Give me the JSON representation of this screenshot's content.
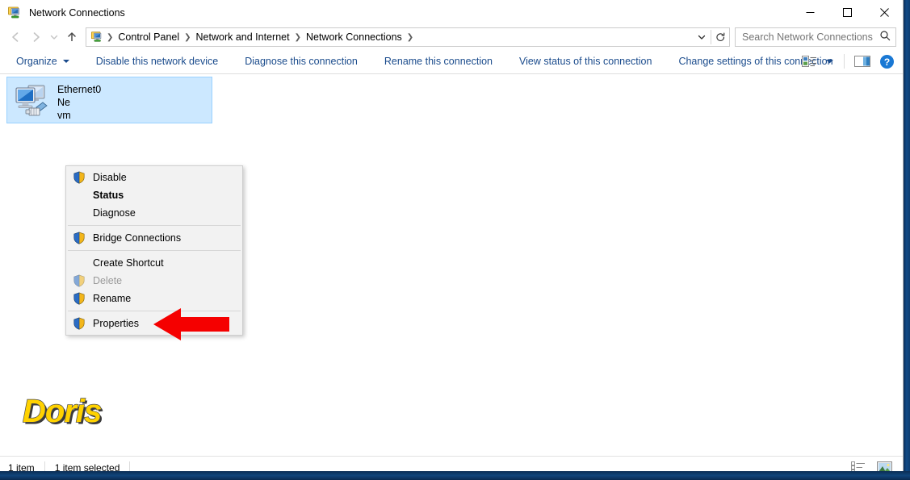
{
  "window": {
    "title": "Network Connections",
    "icon": "network-connections-icon",
    "minimize_label": "Minimize",
    "maximize_label": "Maximize",
    "close_label": "Close"
  },
  "navigation": {
    "back_label": "Back",
    "forward_label": "Forward",
    "recent_label": "Recent locations",
    "up_label": "Up",
    "breadcrumbs": [
      {
        "label": "Control Panel"
      },
      {
        "label": "Network and Internet"
      },
      {
        "label": "Network Connections"
      }
    ],
    "dropdown_label": "Previous locations",
    "refresh_label": "Refresh"
  },
  "search": {
    "placeholder": "Search Network Connections",
    "value": "",
    "icon": "search-icon"
  },
  "commandbar": {
    "items": [
      {
        "label": "Organize",
        "has_caret": true
      },
      {
        "label": "Disable this network device",
        "has_caret": false
      },
      {
        "label": "Diagnose this connection",
        "has_caret": false
      },
      {
        "label": "Rename this connection",
        "has_caret": false
      },
      {
        "label": "View status of this connection",
        "has_caret": false
      },
      {
        "label": "Change settings of this connection",
        "has_caret": false
      }
    ],
    "change_view_label": "Change your view",
    "preview_pane_label": "Show the preview pane",
    "help_label": "Help"
  },
  "connection": {
    "name": "Ethernet0",
    "network": "Ne",
    "adapter": "vm"
  },
  "context_menu": {
    "items": [
      {
        "label": "Disable",
        "shield": true,
        "bold": false,
        "disabled": false
      },
      {
        "label": "Status",
        "shield": false,
        "bold": true,
        "disabled": false
      },
      {
        "label": "Diagnose",
        "shield": false,
        "bold": false,
        "disabled": false
      },
      {
        "separator": true
      },
      {
        "label": "Bridge Connections",
        "shield": true,
        "bold": false,
        "disabled": false
      },
      {
        "separator": true
      },
      {
        "label": "Create Shortcut",
        "shield": false,
        "bold": false,
        "disabled": false
      },
      {
        "label": "Delete",
        "shield": true,
        "bold": false,
        "disabled": true
      },
      {
        "label": "Rename",
        "shield": true,
        "bold": false,
        "disabled": false
      },
      {
        "separator": true
      },
      {
        "label": "Properties",
        "shield": true,
        "bold": false,
        "disabled": false
      }
    ]
  },
  "annotation": {
    "arrow": "red-left-arrow",
    "color": "#f50000"
  },
  "watermark": {
    "text": "Doris",
    "color": "#ffd200"
  },
  "statusbar": {
    "item_count": "1 item",
    "selection": "1 item selected",
    "details_view_label": "Details view",
    "large_icons_view_label": "Large icons view"
  },
  "colors": {
    "accent": "#1a4b8c",
    "selection_fill": "#cce8ff",
    "selection_border": "#99d1ff",
    "menu_bg": "#f2f2f2",
    "desktop_border": "#0f4customize"
  }
}
